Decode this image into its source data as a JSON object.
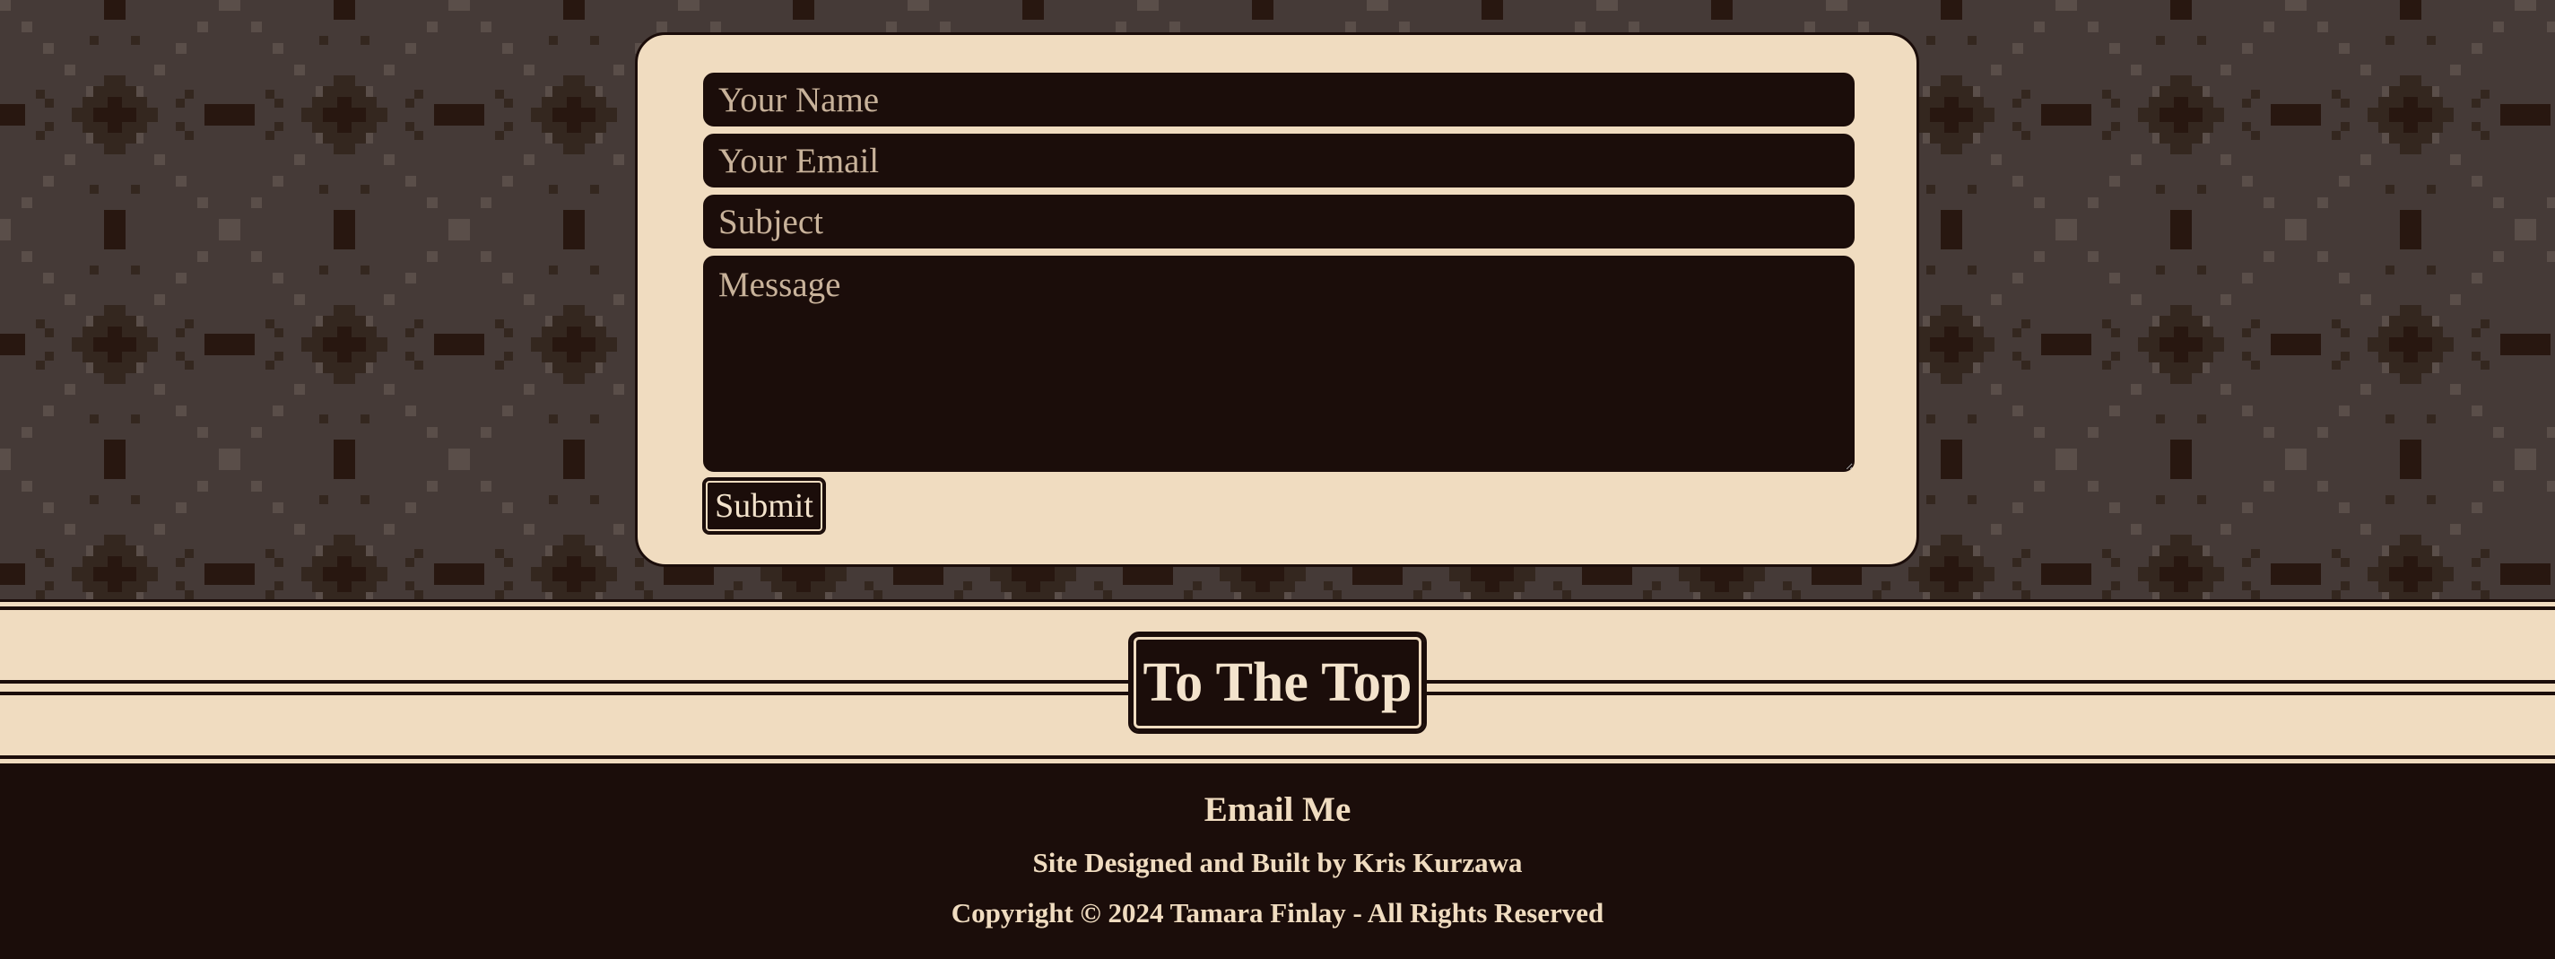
{
  "colors": {
    "dark": "#1b0d0a",
    "cream": "#f0dcc0",
    "pattern_base": "#453a37",
    "pattern_mid": "#34271f",
    "pattern_dark": "#281710"
  },
  "contact_form": {
    "name_placeholder": "Your Name",
    "email_placeholder": "Your Email",
    "subject_placeholder": "Subject",
    "message_placeholder": "Message",
    "submit_label": "Submit"
  },
  "to_top": {
    "label": "To The Top"
  },
  "footer": {
    "email_link": "Email Me",
    "credit": "Site Designed and Built by Kris Kurzawa",
    "copyright": "Copyright © 2024 Tamara Finlay - All Rights Reserved"
  }
}
